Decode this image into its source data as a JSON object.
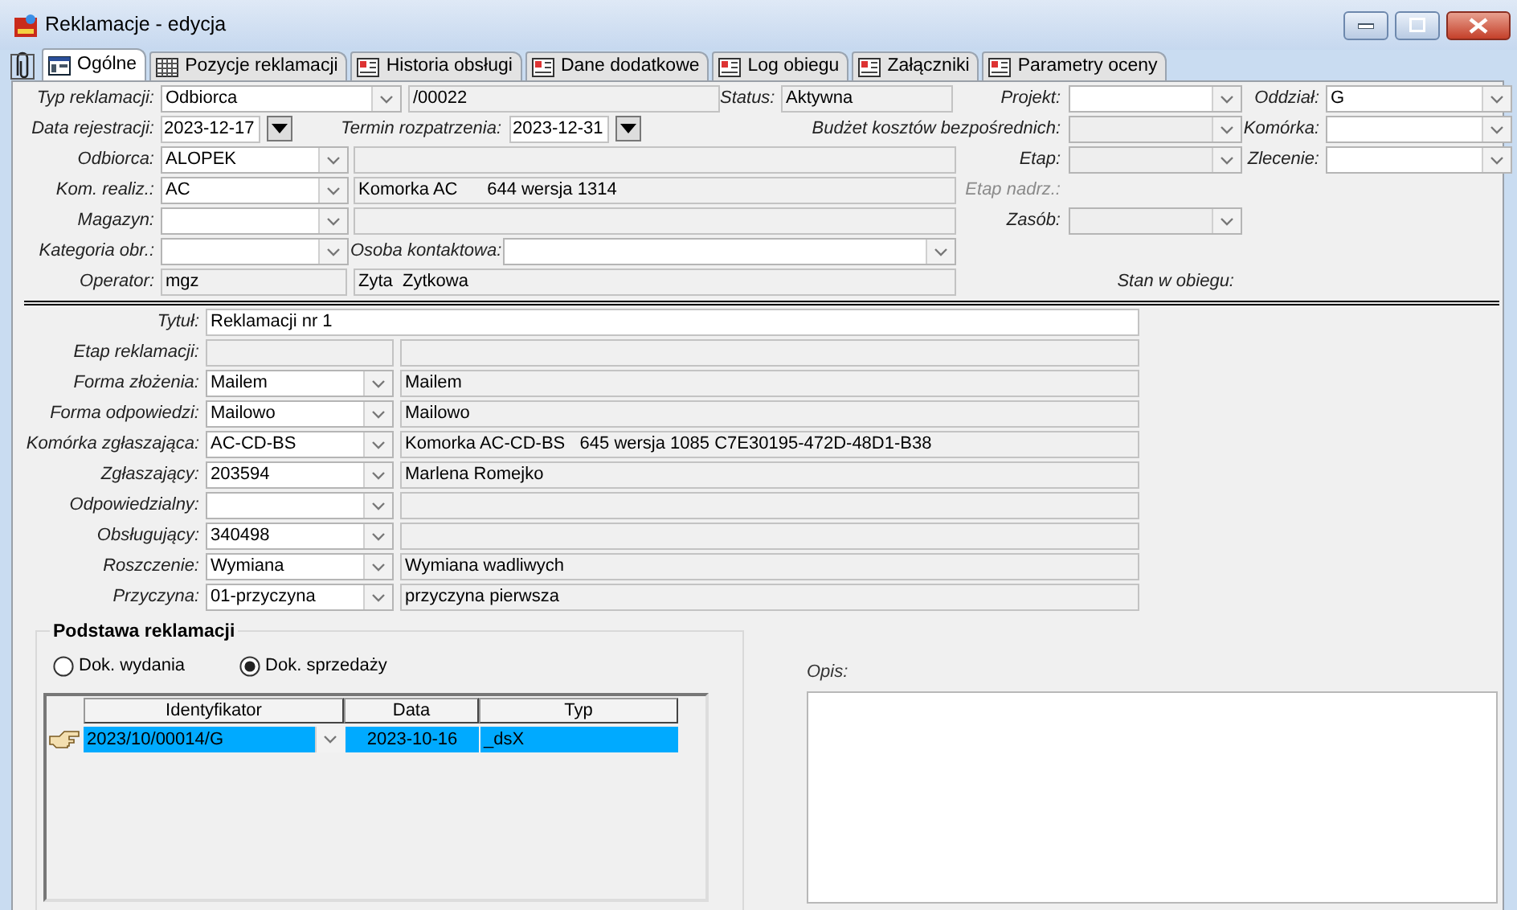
{
  "window": {
    "title": "Reklamacje - edycja"
  },
  "tabs": [
    {
      "label": "Ogólne",
      "selected": true
    },
    {
      "label": "Pozycje reklamacji",
      "selected": false
    },
    {
      "label": "Historia obsługi",
      "selected": false
    },
    {
      "label": "Dane dodatkowe",
      "selected": false
    },
    {
      "label": "Log obiegu",
      "selected": false
    },
    {
      "label": "Załączniki",
      "selected": false
    },
    {
      "label": "Parametry oceny",
      "selected": false
    }
  ],
  "header_rows": [
    [
      {
        "kind": "label",
        "text": "Typ reklamacji:"
      },
      {
        "kind": "combo",
        "value": "Odbiorca",
        "disabled": false
      },
      {
        "kind": "field",
        "value": "/00022",
        "readonly": true
      },
      {
        "kind": "label",
        "text": "Status:"
      },
      {
        "kind": "field",
        "value": "Aktywna",
        "readonly": true
      },
      {
        "kind": "label",
        "text": "Projekt:"
      },
      {
        "kind": "combo",
        "disabled": false
      },
      {
        "kind": "label",
        "text": "Oddział:"
      },
      {
        "kind": "combo",
        "value": "G",
        "disabled": false
      }
    ],
    [
      {
        "kind": "label",
        "text": "Data rejestracji:"
      },
      {
        "kind": "date",
        "value": "2023-12-17"
      },
      {
        "kind": "label",
        "text": "Termin rozpatrzenia:"
      },
      {
        "kind": "date",
        "value": "2023-12-31"
      },
      {
        "kind": "label",
        "text": "Budżet kosztów bezpośrednich:"
      },
      {
        "kind": "combo",
        "disabled": true
      },
      {
        "kind": "label",
        "text": "Komórka:"
      },
      {
        "kind": "combo",
        "disabled": false
      }
    ],
    [
      {
        "kind": "label",
        "text": "Odbiorca:"
      },
      {
        "kind": "combo",
        "value": "ALOPEK",
        "disabled": false
      },
      {
        "kind": "field",
        "readonly": true
      },
      {
        "kind": "label",
        "text": "Etap:"
      },
      {
        "kind": "combo",
        "disabled": true
      },
      {
        "kind": "label",
        "text": "Zlecenie:"
      },
      {
        "kind": "combo",
        "disabled": false
      }
    ],
    [
      {
        "kind": "label",
        "text": "Kom. realiz.:"
      },
      {
        "kind": "combo",
        "value": "AC",
        "disabled": false
      },
      {
        "kind": "field",
        "value": "Komorka AC      644 wersja 1314",
        "readonly": true
      },
      {
        "kind": "label",
        "text": "Etap nadrz.:",
        "disabled": true
      }
    ],
    [
      {
        "kind": "label",
        "text": "Magazyn:"
      },
      {
        "kind": "combo",
        "disabled": false
      },
      {
        "kind": "field",
        "readonly": true
      },
      {
        "kind": "label",
        "text": "Zasób:"
      },
      {
        "kind": "combo",
        "disabled": true
      }
    ],
    [
      {
        "kind": "label",
        "text": "Kategoria obr.:"
      },
      {
        "kind": "combo",
        "disabled": false
      },
      {
        "kind": "label",
        "text": "Osoba kontaktowa:"
      },
      {
        "kind": "combo",
        "disabled": false
      }
    ],
    [
      {
        "kind": "label",
        "text": "Operator:"
      },
      {
        "kind": "field",
        "value": "mgz",
        "readonly": true
      },
      {
        "kind": "field",
        "value": "Zyta  Zytkowa",
        "readonly": true
      },
      {
        "kind": "label",
        "text": "Stan w obiegu:"
      }
    ]
  ],
  "detail_rows": [
    [
      {
        "kind": "label",
        "text": "Tytuł:"
      },
      {
        "kind": "field",
        "value": "Reklamacji nr 1",
        "readonly": false
      }
    ],
    [
      {
        "kind": "label",
        "text": "Etap reklamacji:"
      },
      {
        "kind": "field",
        "readonly": true
      },
      {
        "kind": "field",
        "readonly": true
      }
    ],
    [
      {
        "kind": "label",
        "text": "Forma złożenia:"
      },
      {
        "kind": "combo",
        "value": "Mailem",
        "disabled": false
      },
      {
        "kind": "field",
        "value": "Mailem",
        "readonly": true
      }
    ],
    [
      {
        "kind": "label",
        "text": "Forma odpowiedzi:"
      },
      {
        "kind": "combo",
        "value": "Mailowo",
        "disabled": false
      },
      {
        "kind": "field",
        "value": "Mailowo",
        "readonly": true
      }
    ],
    [
      {
        "kind": "label",
        "text": "Komórka zgłaszająca:"
      },
      {
        "kind": "combo",
        "value": "AC-CD-BS",
        "disabled": false
      },
      {
        "kind": "field",
        "value": "Komorka AC-CD-BS   645 wersja 1085 C7E30195-472D-48D1-B38",
        "readonly": true
      }
    ],
    [
      {
        "kind": "label",
        "text": "Zgłaszający:"
      },
      {
        "kind": "combo",
        "value": "203594",
        "disabled": false
      },
      {
        "kind": "field",
        "value": "Marlena Romejko",
        "readonly": true
      }
    ],
    [
      {
        "kind": "label",
        "text": "Odpowiedzialny:"
      },
      {
        "kind": "combo",
        "disabled": false
      },
      {
        "kind": "field",
        "readonly": true
      }
    ],
    [
      {
        "kind": "label",
        "text": "Obsługujący:"
      },
      {
        "kind": "combo",
        "value": "340498",
        "disabled": false
      },
      {
        "kind": "field",
        "readonly": true
      }
    ],
    [
      {
        "kind": "label",
        "text": "Roszczenie:"
      },
      {
        "kind": "combo",
        "value": "Wymiana",
        "disabled": false
      },
      {
        "kind": "field",
        "value": "Wymiana wadliwych",
        "readonly": true
      }
    ],
    [
      {
        "kind": "label",
        "text": "Przyczyna:"
      },
      {
        "kind": "combo",
        "value": "01-przyczyna",
        "disabled": false
      },
      {
        "kind": "field",
        "value": "przyczyna pierwsza",
        "readonly": true
      }
    ]
  ],
  "basis": {
    "title": "Podstawa reklamacji",
    "options": [
      {
        "label": "Dok. wydania",
        "selected": false
      },
      {
        "label": "Dok. sprzedaży",
        "selected": true
      }
    ],
    "table": {
      "columns": [
        "Identyfikator",
        "Data",
        "Typ"
      ],
      "rows": [
        {
          "cells": [
            "2023/10/00014/G",
            "2023-10-16",
            "_dsX"
          ],
          "selected": true
        }
      ]
    }
  },
  "description": {
    "label": "Opis:"
  }
}
